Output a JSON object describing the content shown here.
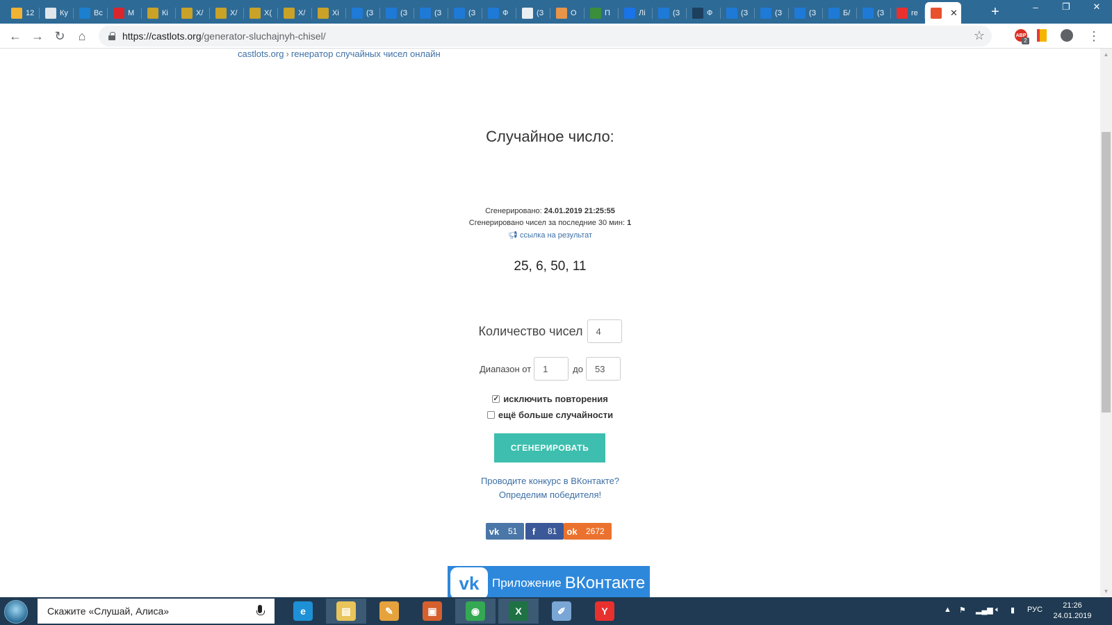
{
  "browser": {
    "tabs": [
      {
        "title": "12",
        "icon": "mail-icon",
        "color": "#f2b233"
      },
      {
        "title": "Ку",
        "icon": "document-icon",
        "color": "#dfe6ec"
      },
      {
        "title": "Вс",
        "icon": "monitor-icon",
        "color": "#1c7fd0"
      },
      {
        "title": "М",
        "icon": "m-logo-icon",
        "color": "#d9262c"
      },
      {
        "title": "Кі",
        "icon": "battery-icon",
        "color": "#c9a227"
      },
      {
        "title": "Х/",
        "icon": "battery-icon",
        "color": "#c9a227"
      },
      {
        "title": "Х/",
        "icon": "battery-icon",
        "color": "#c9a227"
      },
      {
        "title": "Х(",
        "icon": "battery-icon",
        "color": "#c9a227"
      },
      {
        "title": "Х/",
        "icon": "battery-icon",
        "color": "#c9a227"
      },
      {
        "title": "Хі",
        "icon": "battery-icon",
        "color": "#c9a227"
      },
      {
        "title": "(З",
        "icon": "blue-square-icon",
        "color": "#1e7ad6"
      },
      {
        "title": "(З",
        "icon": "blue-square-icon",
        "color": "#1e7ad6"
      },
      {
        "title": "(З",
        "icon": "blue-square-icon",
        "color": "#1e7ad6"
      },
      {
        "title": "(З",
        "icon": "blue-square-icon",
        "color": "#1e7ad6"
      },
      {
        "title": "Ф",
        "icon": "blue-square-icon",
        "color": "#1e7ad6"
      },
      {
        "title": "(З",
        "icon": "bird-icon",
        "color": "#e9eef2"
      },
      {
        "title": "О",
        "icon": "orange-square-icon",
        "color": "#e8954a"
      },
      {
        "title": "П",
        "icon": "triangle-icon",
        "color": "#3b8f3b"
      },
      {
        "title": "Лі",
        "icon": "c-logo-icon",
        "color": "#1a73e8"
      },
      {
        "title": "(З",
        "icon": "blue-square-icon",
        "color": "#1e7ad6"
      },
      {
        "title": "Ф",
        "icon": "mountain-icon",
        "color": "#1d3f5e"
      },
      {
        "title": "(З",
        "icon": "blue-square-icon",
        "color": "#1e7ad6"
      },
      {
        "title": "(З",
        "icon": "blue-square-icon",
        "color": "#1e7ad6"
      },
      {
        "title": "(З",
        "icon": "blue-square-icon",
        "color": "#1e7ad6"
      },
      {
        "title": "Б/",
        "icon": "blue-square-icon",
        "color": "#1e7ad6"
      },
      {
        "title": "(З",
        "icon": "blue-square-icon",
        "color": "#1e7ad6"
      },
      {
        "title": "re",
        "icon": "yandex-icon",
        "color": "#e8302e"
      },
      {
        "title": "",
        "icon": "castlots-icon",
        "color": "#e8502e",
        "active": true
      }
    ],
    "url_host": "https://castlots.org",
    "url_path": "/generator-sluchajnyh-chisel/",
    "ext_badge": "2"
  },
  "page": {
    "breadcrumb_home": "castlots.org",
    "breadcrumb_sep": "›",
    "breadcrumb_current": "генератор случайных чисел онлайн",
    "title": "Случайное число:",
    "generated_label": "Сгенерировано: ",
    "generated_value": "24.01.2019 21:25:55",
    "count30_label": "Сгенерировано чисел за последние 30 мин: ",
    "count30_value": "1",
    "result_link": "ссылка на результат",
    "result": "25, 6, 50, 11",
    "count_label": "Количество чисел",
    "count_value": "4",
    "range_from_label": "Диапазон от",
    "range_from_value": "1",
    "range_to_label": "до",
    "range_to_value": "53",
    "no_repeat_label": "исключить повторения",
    "no_repeat_checked": true,
    "more_random_label": "ещё больше случайности",
    "more_random_checked": false,
    "generate_button": "СГЕНЕРИРОВАТЬ",
    "vk_contest_line1": "Проводите конкурс в ВКонтакте?",
    "vk_contest_line2": "Определим победителя!",
    "share": [
      {
        "name": "vk",
        "glyph": "vk",
        "count": "51",
        "color": "#4a76a8"
      },
      {
        "name": "facebook",
        "glyph": "f",
        "count": "81",
        "color": "#3b5998"
      },
      {
        "name": "odnoklassniki",
        "glyph": "ok",
        "count": "2672",
        "color": "#eb722e"
      }
    ],
    "vk_app_banner_1": "Приложение",
    "vk_app_banner_2": "ВКонтакте"
  },
  "taskbar": {
    "search_text": "Скажите «Слушай, Алиса»",
    "apps": [
      {
        "name": "internet-explorer",
        "glyph": "e",
        "color": "#1e90d6",
        "open": false
      },
      {
        "name": "file-explorer",
        "glyph": "▤",
        "color": "#e8c45a",
        "open": true
      },
      {
        "name": "ruler-app",
        "glyph": "✎",
        "color": "#e6a23c",
        "open": false
      },
      {
        "name": "powerpoint-app",
        "glyph": "▣",
        "color": "#d5602e",
        "open": false
      },
      {
        "name": "chrome",
        "glyph": "◉",
        "color": "#34a853",
        "open": true
      },
      {
        "name": "excel",
        "glyph": "X",
        "color": "#1f7244",
        "open": true
      },
      {
        "name": "paint",
        "glyph": "✐",
        "color": "#7aa6d6",
        "open": false
      },
      {
        "name": "yandex-browser",
        "glyph": "Y",
        "color": "#e8302e",
        "open": false
      }
    ],
    "lang": "РУС",
    "time": "21:26",
    "date": "24.01.2019"
  },
  "colors": {
    "accent_button": "#3dbeae",
    "link": "#3d6fa5",
    "tabstrip": "#2e6a96",
    "taskbar": "#1f3a52"
  }
}
